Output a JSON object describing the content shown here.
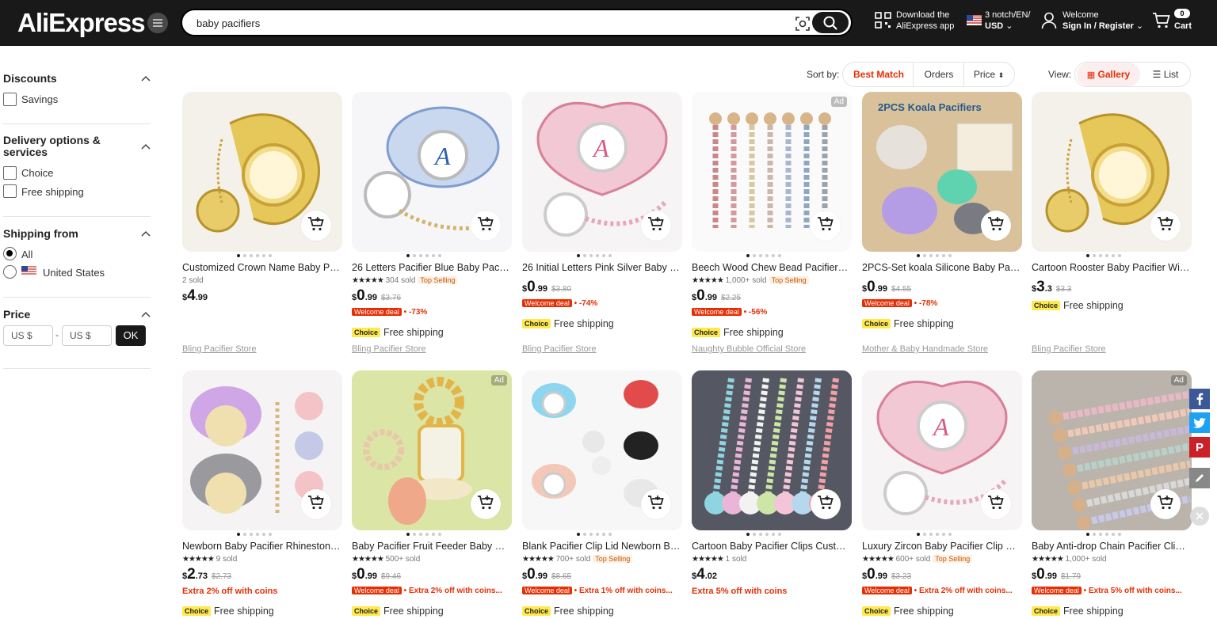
{
  "header": {
    "logo": "AliExpress",
    "search_value": "baby pacifiers",
    "download_line1": "Download the",
    "download_line2": "AliExpress app",
    "locale_line1": "3 notch/EN/",
    "locale_line2": "USD",
    "account_line1": "Welcome",
    "account_line2": "Sign In / Register",
    "cart_count": "0",
    "cart_label": "Cart"
  },
  "filters": {
    "discounts_title": "Discounts",
    "savings": "Savings",
    "delivery_title_1": "Delivery options &",
    "delivery_title_2": "services",
    "choice": "Choice",
    "free_shipping": "Free shipping",
    "shipping_from_title": "Shipping from",
    "all": "All",
    "us": "United States",
    "price_title": "Price",
    "min_placeholder": "US $",
    "dash": "-",
    "max_placeholder": "US $",
    "ok": "OK"
  },
  "sort": {
    "label": "Sort by:",
    "best_match": "Best Match",
    "orders": "Orders",
    "price": "Price",
    "view_label": "View:",
    "gallery": "Gallery",
    "list": "List"
  },
  "colors": {
    "accent": "#e62e04",
    "header_bg": "#191919",
    "choice_yellow": "#ffe94d"
  },
  "products": [
    {
      "title": "Customized Crown Name Baby Paci...",
      "rating": "",
      "sold": "2 sold",
      "top": "",
      "cur": "$",
      "int": "4",
      "dec": ".99",
      "old": "",
      "deal": "",
      "discount": "",
      "extra": "",
      "ship": "",
      "choice": "",
      "store": "Bling Pacifier Store",
      "ad": "",
      "bg": "#f4f1ea",
      "art": "gold"
    },
    {
      "title": "26 Letters Pacifier Blue Baby Pacifie...",
      "rating": "★★★★★",
      "sold": "304 sold",
      "top": "Top Selling",
      "cur": "$",
      "int": "0",
      "dec": ".99",
      "old": "$3.76",
      "deal": "Welcome deal",
      "discount": "-73%",
      "extra": "",
      "ship": "Free shipping",
      "choice": "Choice",
      "store": "Bling Pacifier Store",
      "ad": "",
      "bg": "#f6f6f8",
      "art": "blue"
    },
    {
      "title": "26 Initial Letters Pink Silver Baby Pa...",
      "rating": "",
      "sold": "",
      "top": "",
      "cur": "$",
      "int": "0",
      "dec": ".99",
      "old": "$3.80",
      "deal": "Welcome deal",
      "discount": "-74%",
      "extra": "",
      "ship": "Free shipping",
      "choice": "Choice",
      "store": "Bling Pacifier Store",
      "ad": "",
      "bg": "#f6f4f5",
      "art": "pink"
    },
    {
      "title": "Beech Wood Chew Bead Pacifier Cli...",
      "rating": "★★★★★",
      "sold": "1,000+ sold",
      "top": "Top Selling",
      "cur": "$",
      "int": "0",
      "dec": ".99",
      "old": "$2.25",
      "deal": "Welcome deal",
      "discount": "-56%",
      "extra": "",
      "ship": "Free shipping",
      "choice": "Choice",
      "store": "Naughty Bubble Official Store",
      "ad": "Ad",
      "bg": "#fafafa",
      "art": "beads"
    },
    {
      "title": "2PCS-Set koala Silicone Baby Pacifie...",
      "rating": "",
      "sold": "",
      "top": "",
      "cur": "$",
      "int": "0",
      "dec": ".99",
      "old": "$4.55",
      "deal": "Welcome deal",
      "discount": "-78%",
      "extra": "",
      "ship": "Free shipping",
      "choice": "Choice",
      "store": "Mother & Baby Handmade Store",
      "ad": "",
      "bg": "#d9c29b",
      "art": "koala"
    },
    {
      "title": "Cartoon Rooster Baby Pacifier With ...",
      "rating": "",
      "sold": "",
      "top": "",
      "cur": "$",
      "int": "3",
      "dec": ".3",
      "old": "$3.3",
      "deal": "",
      "discount": "",
      "extra": "",
      "ship": "Free shipping",
      "choice": "Choice",
      "store": "Bling Pacifier Store",
      "ad": "",
      "bg": "#f4f1ea",
      "art": "gold"
    },
    {
      "title": "Newborn Baby Pacifier Rhinestone ...",
      "rating": "★★★★★",
      "sold": "9 sold",
      "top": "",
      "cur": "$",
      "int": "2",
      "dec": ".73",
      "old": "$2.73",
      "deal": "",
      "discount": "",
      "extra": "Extra 2% off with coins",
      "ship": "Free shipping",
      "choice": "Choice",
      "store": "",
      "ad": "",
      "bg": "#f5f3f3",
      "art": "purple"
    },
    {
      "title": "Baby Pacifier Fruit Feeder Baby Silic...",
      "rating": "★★★★★",
      "sold": "500+ sold",
      "top": "",
      "cur": "$",
      "int": "0",
      "dec": ".99",
      "old": "$9.46",
      "deal": "Welcome deal",
      "discount": "",
      "extra": "Extra 2% off with coins...",
      "ship": "Free shipping",
      "choice": "Choice",
      "store": "",
      "ad": "Ad",
      "bg": "#dfe7b0",
      "art": "feeder"
    },
    {
      "title": "Blank Pacifier Clip Lid Newborn Bab...",
      "rating": "★★★★★",
      "sold": "700+ sold",
      "top": "Top Selling",
      "cur": "$",
      "int": "0",
      "dec": ".99",
      "old": "$8.65",
      "deal": "Welcome deal",
      "discount": "",
      "extra": "Extra 1% off with coins...",
      "ship": "Free shipping",
      "choice": "Choice",
      "store": "",
      "ad": "",
      "bg": "#f7f7f7",
      "art": "blank"
    },
    {
      "title": "Cartoon Baby Pacifier Clips Custom...",
      "rating": "★★★★★",
      "sold": "1 sold",
      "top": "",
      "cur": "$",
      "int": "4",
      "dec": ".02",
      "old": "",
      "deal": "",
      "discount": "",
      "extra": "Extra 5% off with coins",
      "ship": "",
      "choice": "",
      "store": "",
      "ad": "",
      "bg": "#595c66",
      "art": "clips"
    },
    {
      "title": "Luxury Zircon Baby Pacifier Clip Pin...",
      "rating": "★★★★★",
      "sold": "600+ sold",
      "top": "Top Selling",
      "cur": "$",
      "int": "0",
      "dec": ".99",
      "old": "$3.23",
      "deal": "Welcome deal",
      "discount": "",
      "extra": "Extra 2% off with coins...",
      "ship": "Free shipping",
      "choice": "Choice",
      "store": "",
      "ad": "",
      "bg": "#f6f4f5",
      "art": "pink"
    },
    {
      "title": "Baby Anti-drop Chain Pacifier Clips ...",
      "rating": "★★★★★",
      "sold": "1,000+ sold",
      "top": "",
      "cur": "$",
      "int": "0",
      "dec": ".99",
      "old": "$1.79",
      "deal": "Welcome deal",
      "discount": "",
      "extra": "Extra 5% off with coins...",
      "ship": "Free shipping",
      "choice": "Choice",
      "store": "",
      "ad": "Ad",
      "bg": "#b9b4ad",
      "art": "chains"
    }
  ]
}
